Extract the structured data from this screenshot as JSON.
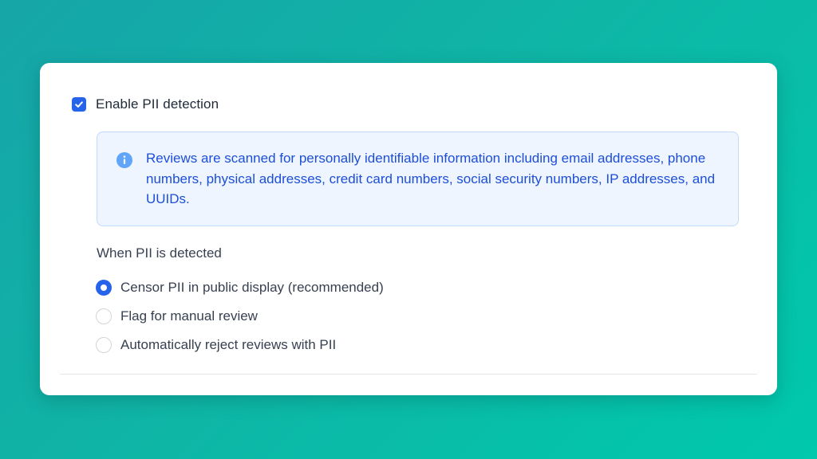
{
  "pii_settings": {
    "enable_checkbox": {
      "label": "Enable PII detection",
      "checked": true
    },
    "info_box": {
      "icon": "info-icon",
      "text": "Reviews are scanned for personally identifiable information including email addresses, phone numbers, physical addresses, credit card numbers, social security numbers, IP addresses, and UUIDs."
    },
    "action_section": {
      "title": "When PII is detected",
      "selected_index": 0,
      "options": [
        {
          "label": "Censor PII in public display (recommended)"
        },
        {
          "label": "Flag for manual review"
        },
        {
          "label": "Automatically reject reviews with PII"
        }
      ]
    }
  },
  "colors": {
    "accent": "#2563eb",
    "info_text": "#1d4ed8",
    "info_background": "#eef5ff",
    "background_start": "#16a5a8",
    "background_end": "#00c9ad"
  }
}
